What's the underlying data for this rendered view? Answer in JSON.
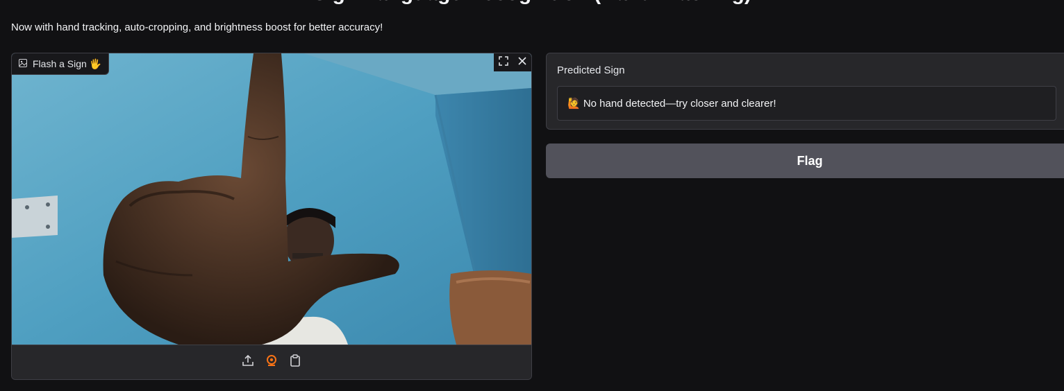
{
  "header": {
    "title": "Sign Language Recognition (Hand Tracking)",
    "subtitle": "Now with hand tracking, auto-cropping, and brightness boost for better accuracy!"
  },
  "image_input": {
    "label": "Flash a Sign 🖐",
    "icons": [
      "image-icon",
      "fullscreen-icon",
      "close-icon",
      "upload-icon",
      "webcam-icon",
      "clipboard-icon"
    ]
  },
  "output": {
    "label": "Predicted Sign",
    "value": "🙋 No hand detected—try closer and clearer!"
  },
  "flag_button": {
    "label": "Flag"
  },
  "colors": {
    "background": "#111113",
    "panel": "#27272a",
    "border": "#3f3f46",
    "button": "#52525b",
    "webcam_accent": "#f97316"
  }
}
